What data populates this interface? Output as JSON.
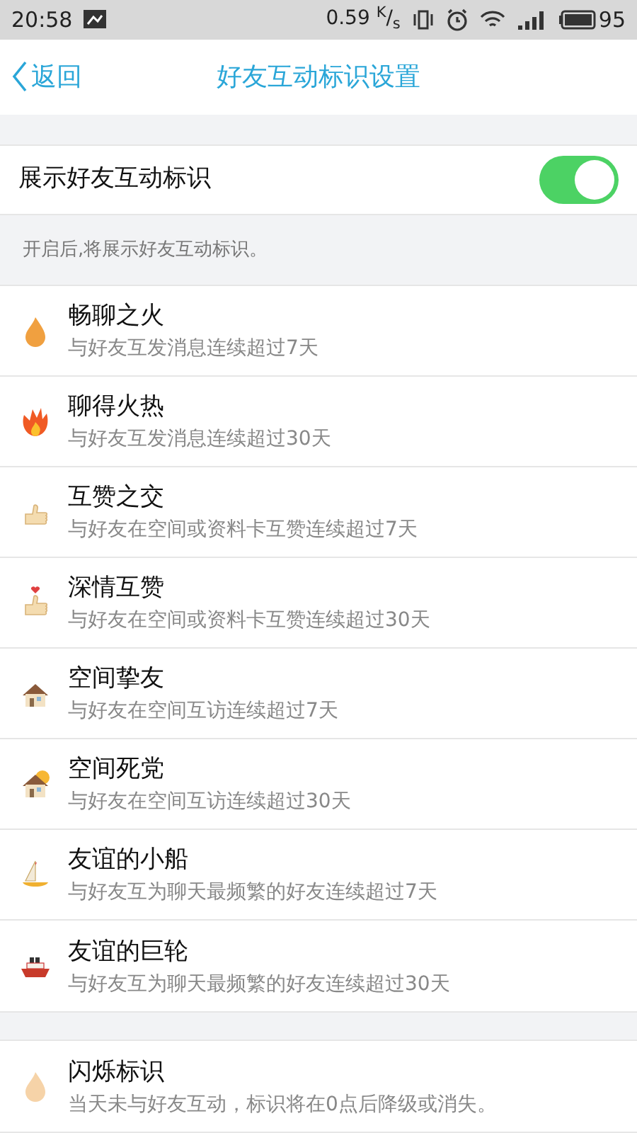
{
  "status_bar": {
    "time": "20:58",
    "speed": "0.59 $^{K}$/$_{s}$",
    "battery": "95"
  },
  "header": {
    "back": "返回",
    "title": "好友互动标识设置"
  },
  "toggle": {
    "label": "展示好友互动标识",
    "on": true,
    "hint": "开启后,将展示好友互动标识。"
  },
  "badges": [
    {
      "kind": "flame",
      "title": "畅聊之火",
      "desc": "与好友互发消息连续超过7天"
    },
    {
      "kind": "fire",
      "title": "聊得火热",
      "desc": "与好友互发消息连续超过30天"
    },
    {
      "kind": "thumb",
      "title": "互赞之交",
      "desc": "与好友在空间或资料卡互赞连续超过7天"
    },
    {
      "kind": "thumb-heart",
      "title": "深情互赞",
      "desc": "与好友在空间或资料卡互赞连续超过30天"
    },
    {
      "kind": "house",
      "title": "空间挚友",
      "desc": "与好友在空间互访连续超过7天"
    },
    {
      "kind": "house-sun",
      "title": "空间死党",
      "desc": "与好友在空间互访连续超过30天"
    },
    {
      "kind": "sailboat",
      "title": "友谊的小船",
      "desc": "与好友互为聊天最频繁的好友连续超过7天"
    },
    {
      "kind": "ship",
      "title": "友谊的巨轮",
      "desc": "与好友互为聊天最频繁的好友连续超过30天"
    }
  ],
  "flash": {
    "kind": "pale-flame",
    "title": "闪烁标识",
    "desc": "当天未与好友互动，标识将在0点后降级或消失。"
  }
}
